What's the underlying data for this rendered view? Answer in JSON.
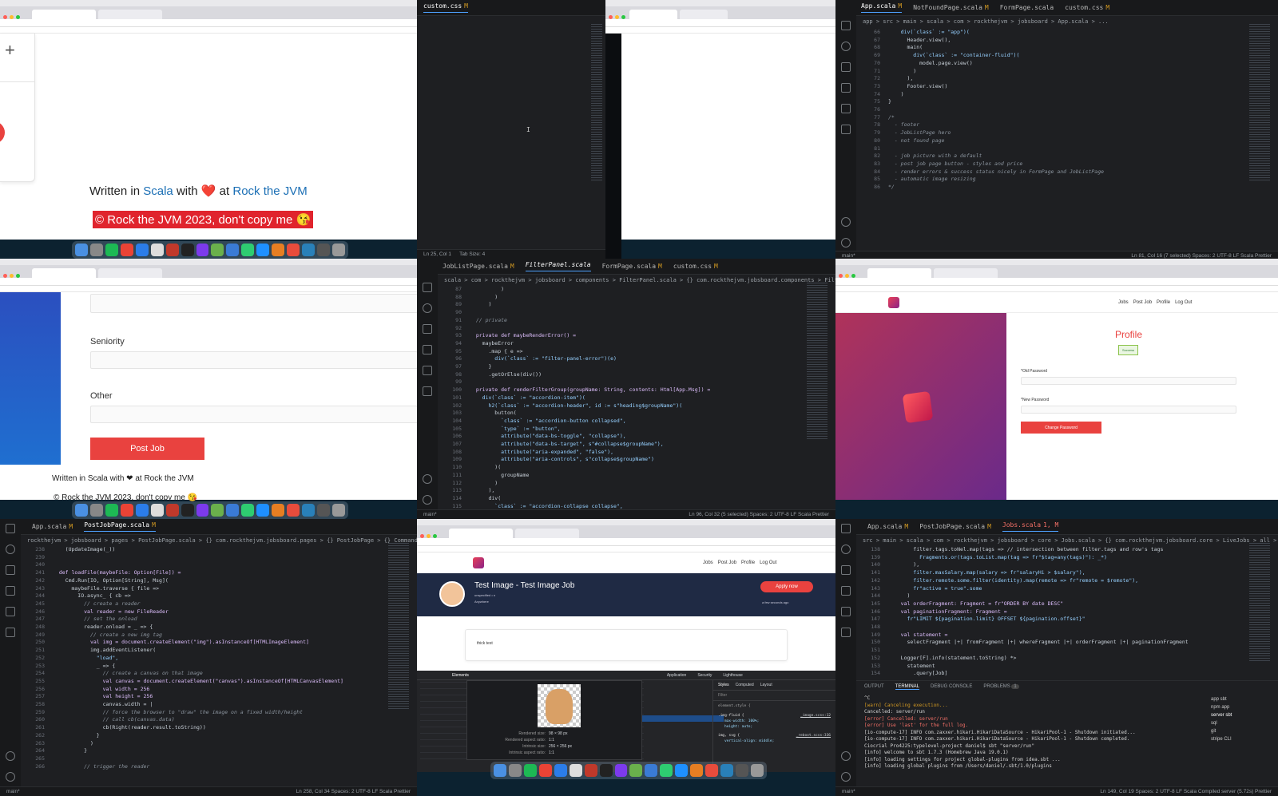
{
  "tile_browser_footer": {
    "footer_written": "Written in",
    "footer_scala": "Scala",
    "footer_with": "with",
    "footer_at": "at",
    "footer_rtjvm": "Rock the JVM",
    "copyright": "© Rock the JVM 2023, don't copy me 😘",
    "plus": "+"
  },
  "tile_editor_css": {
    "tab": "custom.css",
    "tab_status": "M",
    "status_left": "Ln 25, Col 1",
    "status_tab": "Tab Size: 4"
  },
  "tile_editor_app": {
    "tabs": [
      {
        "label": "App.scala",
        "status": "M"
      },
      {
        "label": "NotFoundPage.scala",
        "status": "M"
      },
      {
        "label": "FormPage.scala",
        "status": ""
      },
      {
        "label": "custom.css",
        "status": "M"
      }
    ],
    "breadcrumb": "app > src > main > scala > com > rockthejvm > jobsboard > App.scala > ...",
    "lines": [
      {
        "n": "66",
        "t": "    div(`class` := \"app\")("
      },
      {
        "n": "67",
        "t": "      Header.view(),"
      },
      {
        "n": "68",
        "t": "      main("
      },
      {
        "n": "69",
        "t": "        div(`class` := \"container-fluid\")("
      },
      {
        "n": "70",
        "t": "          model.page.view()"
      },
      {
        "n": "71",
        "t": "        )"
      },
      {
        "n": "72",
        "t": "      ),"
      },
      {
        "n": "73",
        "t": "      Footer.view()"
      },
      {
        "n": "74",
        "t": "    )"
      },
      {
        "n": "75",
        "t": "}"
      },
      {
        "n": "76",
        "t": ""
      },
      {
        "n": "77",
        "t": "/*"
      },
      {
        "n": "78",
        "t": "  - footer"
      },
      {
        "n": "79",
        "t": "  - JobListPage hero"
      },
      {
        "n": "80",
        "t": "  - not found page"
      },
      {
        "n": "81",
        "t": ""
      },
      {
        "n": "82",
        "t": "  - job picture with a default"
      },
      {
        "n": "83",
        "t": "  - post job page button - styles and price"
      },
      {
        "n": "84",
        "t": "  - render errors & success status nicely in FormPage and JobListPage"
      },
      {
        "n": "85",
        "t": "  - automatic image resizing"
      },
      {
        "n": "86",
        "t": "*/"
      }
    ],
    "status_left": "main*",
    "status_right": "Ln 81, Col 16 (7 selected)   Spaces: 2   UTF-8   LF   Scala   Prettier"
  },
  "tile_browser_form": {
    "seniority": "Seniority",
    "other": "Other",
    "post_job": "Post Job",
    "footer": "Written in Scala with ❤ at Rock the JVM",
    "copyright": "© Rock the JVM 2023, don't copy me 😘"
  },
  "tile_editor_filter": {
    "tabs": [
      {
        "label": "JobListPage.scala",
        "status": "M"
      },
      {
        "label": "FilterPanel.scala",
        "status": ""
      },
      {
        "label": "FormPage.scala",
        "status": "M"
      },
      {
        "label": "custom.css",
        "status": "M"
      }
    ],
    "breadcrumb": "scala > com > rockthejvm > jobsboard > components > FilterPanel.scala > {} com.rockthejvm.jobsboard.components > FilterPanel",
    "lines": [
      {
        "n": "87",
        "t": "          )"
      },
      {
        "n": "88",
        "t": "        )"
      },
      {
        "n": "89",
        "t": "      )"
      },
      {
        "n": "90",
        "t": ""
      },
      {
        "n": "91",
        "t": "  // private"
      },
      {
        "n": "92",
        "t": ""
      },
      {
        "n": "93",
        "t": "  private def maybeRenderError() ="
      },
      {
        "n": "94",
        "t": "    maybeError"
      },
      {
        "n": "95",
        "t": "      .map { e =>"
      },
      {
        "n": "96",
        "t": "        div(`class` := \"filter-panel-error\")(e)"
      },
      {
        "n": "97",
        "t": "      }"
      },
      {
        "n": "98",
        "t": "      .getOrElse(div())"
      },
      {
        "n": "99",
        "t": ""
      },
      {
        "n": "100",
        "t": "  private def renderFilterGroup(groupName: String, contents: Html[App.Msg]) ="
      },
      {
        "n": "101",
        "t": "    div(`class` := \"accordion-item\")("
      },
      {
        "n": "102",
        "t": "      h2(`class` := \"accordion-header\", id := s\"heading$groupName\")("
      },
      {
        "n": "103",
        "t": "        button("
      },
      {
        "n": "104",
        "t": "          `class` := \"accordion-button collapsed\","
      },
      {
        "n": "105",
        "t": "          `type` := \"button\","
      },
      {
        "n": "106",
        "t": "          attribute(\"data-bs-toggle\", \"collapse\"),"
      },
      {
        "n": "107",
        "t": "          attribute(\"data-bs-target\", s\"#collapse$groupName\"),"
      },
      {
        "n": "108",
        "t": "          attribute(\"aria-expanded\", \"false\"),"
      },
      {
        "n": "109",
        "t": "          attribute(\"aria-controls\", s\"collapse$groupName\")"
      },
      {
        "n": "110",
        "t": "        )("
      },
      {
        "n": "111",
        "t": "          groupName"
      },
      {
        "n": "112",
        "t": "        )"
      },
      {
        "n": "113",
        "t": "      ),"
      },
      {
        "n": "114",
        "t": "      div("
      },
      {
        "n": "115",
        "t": "        `class` := \"accordion-collapse collapse\","
      }
    ],
    "status_left": "main*",
    "status_right": "Ln 96, Col 32 (5 selected)   Spaces: 2   UTF-8   LF   Scala   Prettier"
  },
  "tile_browser_profile": {
    "nav": [
      "Jobs",
      "Post Job",
      "Profile",
      "Log Out"
    ],
    "title": "Profile",
    "badge": "Success",
    "old_password": "*Old Password",
    "new_password": "*New Password",
    "change_password": "Change Password"
  },
  "tile_editor_postjob": {
    "tabs": [
      {
        "label": "App.scala",
        "status": "M"
      },
      {
        "label": "PostJobPage.scala",
        "status": "M"
      }
    ],
    "breadcrumb": "rockthejvm > jobsboard > pages > PostJobPage.scala > {} com.rockthejvm.jobsboard.pages > {} PostJobPage > {} Commands > loadFile",
    "lines": [
      {
        "n": "238",
        "t": "    (UpdateImage(_))"
      },
      {
        "n": "239",
        "t": ""
      },
      {
        "n": "240",
        "t": ""
      },
      {
        "n": "241",
        "t": "  def loadFile(maybeFile: Option[File]) ="
      },
      {
        "n": "242",
        "t": "    Cmd.Run[IO, Option[String], Msg]("
      },
      {
        "n": "243",
        "t": "      maybeFile.traverse { file =>"
      },
      {
        "n": "244",
        "t": "        IO.async_ { cb =>"
      },
      {
        "n": "245",
        "t": "          // create a reader"
      },
      {
        "n": "246",
        "t": "          val reader = new FileReader"
      },
      {
        "n": "247",
        "t": "          // set the onload"
      },
      {
        "n": "248",
        "t": "          reader.onload = _ => {"
      },
      {
        "n": "249",
        "t": "            // create a new img tag"
      },
      {
        "n": "250",
        "t": "            val img = document.createElement(\"img\").asInstanceOf[HTMLImageElement]"
      },
      {
        "n": "251",
        "t": "            img.addEventListener("
      },
      {
        "n": "252",
        "t": "              \"load\","
      },
      {
        "n": "253",
        "t": "              _ => {"
      },
      {
        "n": "254",
        "t": "                // create a canvas on that image"
      },
      {
        "n": "255",
        "t": "                val canvas = document.createElement(\"canvas\").asInstanceOf[HTMLCanvasElement]"
      },
      {
        "n": "256",
        "t": "                val width = 256"
      },
      {
        "n": "257",
        "t": "                val height = 256"
      },
      {
        "n": "258",
        "t": "                canvas.width = |"
      },
      {
        "n": "259",
        "t": "                // force the browser to \"draw\" the image on a fixed width/height"
      },
      {
        "n": "260",
        "t": "                // call cb(canvas.data)"
      },
      {
        "n": "261",
        "t": "                cb(Right(reader.result.toString))"
      },
      {
        "n": "262",
        "t": "              }"
      },
      {
        "n": "263",
        "t": "            )"
      },
      {
        "n": "264",
        "t": "          }"
      },
      {
        "n": "265",
        "t": ""
      },
      {
        "n": "266",
        "t": "          // trigger the reader"
      }
    ],
    "status_left": "main*",
    "status_right": "Ln 258, Col 34   Spaces: 2   UTF-8   LF   Scala   Prettier"
  },
  "tile_browser_job": {
    "nav": [
      "Jobs",
      "Post Job",
      "Profile",
      "Log Out"
    ],
    "job_title": "Test Image - Test Image Job",
    "job_meta1": "unspecified • n",
    "job_meta2": "Anywhere",
    "apply": "Apply now",
    "posted": "a few seconds ago",
    "desc": "thick test",
    "devtools_tabs": [
      "Elements",
      "Application",
      "Security",
      "Lighthouse"
    ],
    "styles_tabs": [
      "Styles",
      "Computed",
      "Layout"
    ],
    "filter": "Filter",
    "rendered_size": "98 × 98 px",
    "rendered_ratio": "1:1",
    "intrinsic_size": "256 × 256 px",
    "intrinsic_ratio": "1:1",
    "size_labels": [
      "Rendered size:",
      "Rendered aspect ratio:",
      "Intrinsic size:",
      "Intrinsic aspect ratio:"
    ],
    "css_rule": ".img-fluid {",
    "css_decl1": "max-width: 100%;",
    "css_decl2": "height: auto;",
    "css_src": "_image.scss:12",
    "css_rule2": "img, svg {",
    "css_decl3": "vertical-align: middle;",
    "css_src2": "_reboot.scss:336",
    "element_style": "element.style {"
  },
  "tile_editor_jobs": {
    "tabs": [
      {
        "label": "App.scala",
        "status": "M"
      },
      {
        "label": "PostJobPage.scala",
        "status": "M"
      },
      {
        "label": "Jobs.scala",
        "status": "1, M"
      }
    ],
    "breadcrumb": "src > main > scala > com > rockthejvm > jobsboard > core > Jobs.scala > {} com.rockthejvm.jobsboard.core > LiveJobs > all > statement",
    "lines": [
      {
        "n": "138",
        "t": "        filter.tags.toNel.map(tags => // intersection between filter.tags and row's tags"
      },
      {
        "n": "139",
        "t": "          Fragments.or(tags.toList.map(tag => fr\"$tag=any(tags)\"): _*)"
      },
      {
        "n": "140",
        "t": "        ),"
      },
      {
        "n": "141",
        "t": "        filter.maxSalary.map(salary => fr\"salaryHi > $salary\"),"
      },
      {
        "n": "142",
        "t": "        filter.remote.some.filter(identity).map(remote => fr\"remote = $remote\"),"
      },
      {
        "n": "143",
        "t": "        fr\"active = true\".some"
      },
      {
        "n": "144",
        "t": "      )"
      },
      {
        "n": "145",
        "t": "    val orderFragment: Fragment = fr\"ORDER BY date DESC\""
      },
      {
        "n": "146",
        "t": "    val paginationFragment: Fragment ="
      },
      {
        "n": "147",
        "t": "      fr\"LIMIT ${pagination.limit} OFFSET ${pagination.offset}\""
      },
      {
        "n": "148",
        "t": ""
      },
      {
        "n": "149",
        "t": "    val statement ="
      },
      {
        "n": "150",
        "t": "      selectFragment |+| fromFragment |+| whereFragment |+| orderFragment |+| paginationFragment"
      },
      {
        "n": "151",
        "t": ""
      },
      {
        "n": "152",
        "t": "    Logger[F].info(statement.toString) *>"
      },
      {
        "n": "153",
        "t": "      statement"
      },
      {
        "n": "154",
        "t": "        .query[Job]"
      }
    ],
    "panel_tabs": [
      "OUTPUT",
      "TERMINAL",
      "DEBUG CONSOLE",
      "PROBLEMS"
    ],
    "problems_count": "1",
    "terminal": [
      "^C",
      "[warn] Canceling execution...",
      "Cancelled: server/run",
      "[error] Cancelled: server/run",
      "[error] Use 'last' for the full log.",
      "[io-compute-17] INFO com.zaxxer.hikari.HikariDataSource - HikariPool-1 - Shutdown initiated...",
      "[io-compute-17] INFO com.zaxxer.hikari.HikariDataSource - HikariPool-1 - Shutdown completed.",
      "Ciocrial Pro4225:typelevel-project daniel$ sbt \"server/run\"",
      "[info] welcome to sbt 1.7.3 (Homebrew Java 19.0.1)",
      "[info] loading settings for project global-plugins from idea.sbt ...",
      "[info] loading global plugins from /Users/daniel/.sbt/1.0/plugins"
    ],
    "terminals": [
      "app sbt",
      "npm app",
      "server sbt",
      "sql",
      "git",
      "stripe CLI"
    ],
    "status_left": "main*",
    "status_right": "Ln 149, Col 19   Spaces: 2   UTF-8   LF   Scala   Compiled server (5.72s)   Prettier"
  },
  "colors": {
    "accent_red": "#e9423f",
    "link_blue": "#1b6fb5",
    "editor_bg": "#1e1f22"
  }
}
